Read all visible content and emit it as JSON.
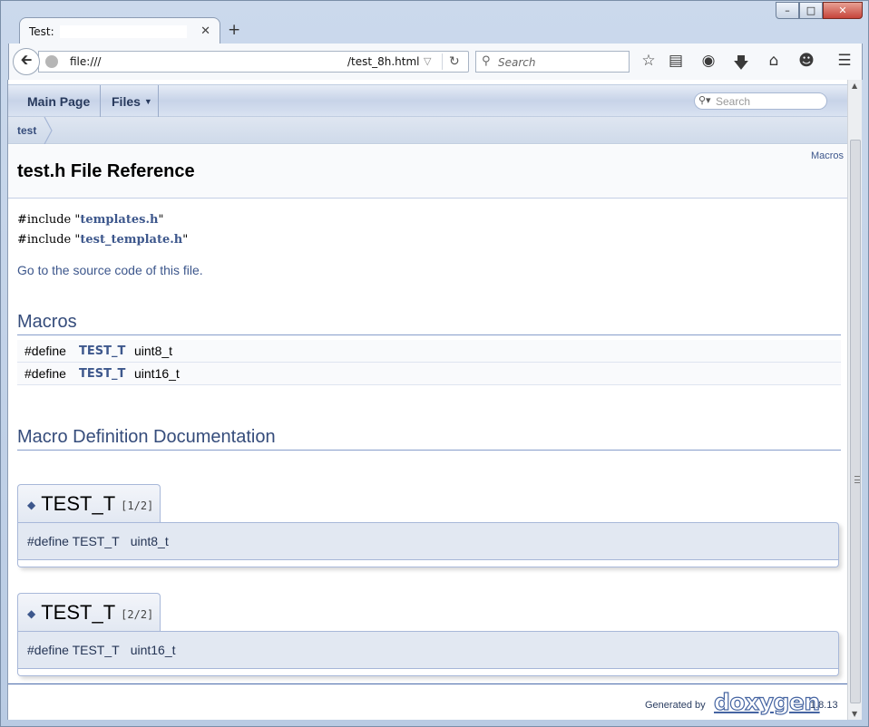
{
  "browser": {
    "tab_title": "Test:",
    "url_left": "file:///",
    "url_right": "/test_8h.html",
    "search_placeholder": "Search"
  },
  "nav": {
    "main_page": "Main Page",
    "files": "Files",
    "search_placeholder": "Search"
  },
  "breadcrumb": "test",
  "header": {
    "summary_link": "Macros",
    "title": "test.h File Reference"
  },
  "includes": [
    {
      "prefix": "#include \"",
      "file": "templates.h",
      "suffix": "\""
    },
    {
      "prefix": "#include \"",
      "file": "test_template.h",
      "suffix": "\""
    }
  ],
  "source_link": "Go to the source code of this file.",
  "macros_section": {
    "title": "Macros",
    "rows": [
      {
        "kw": "#define",
        "name": "TEST_T",
        "value": "uint8_t"
      },
      {
        "kw": "#define",
        "name": "TEST_T",
        "value": "uint16_t"
      }
    ]
  },
  "docs_section": {
    "title": "Macro Definition Documentation",
    "items": [
      {
        "name": "TEST_T",
        "overload": "[1/2]",
        "kw": "#define TEST_T",
        "value": "uint8_t"
      },
      {
        "name": "TEST_T",
        "overload": "[2/2]",
        "kw": "#define TEST_T",
        "value": "uint16_t"
      }
    ]
  },
  "footer": {
    "generated_by": "Generated by",
    "logo": "doxygen",
    "version": "1.8.13"
  }
}
